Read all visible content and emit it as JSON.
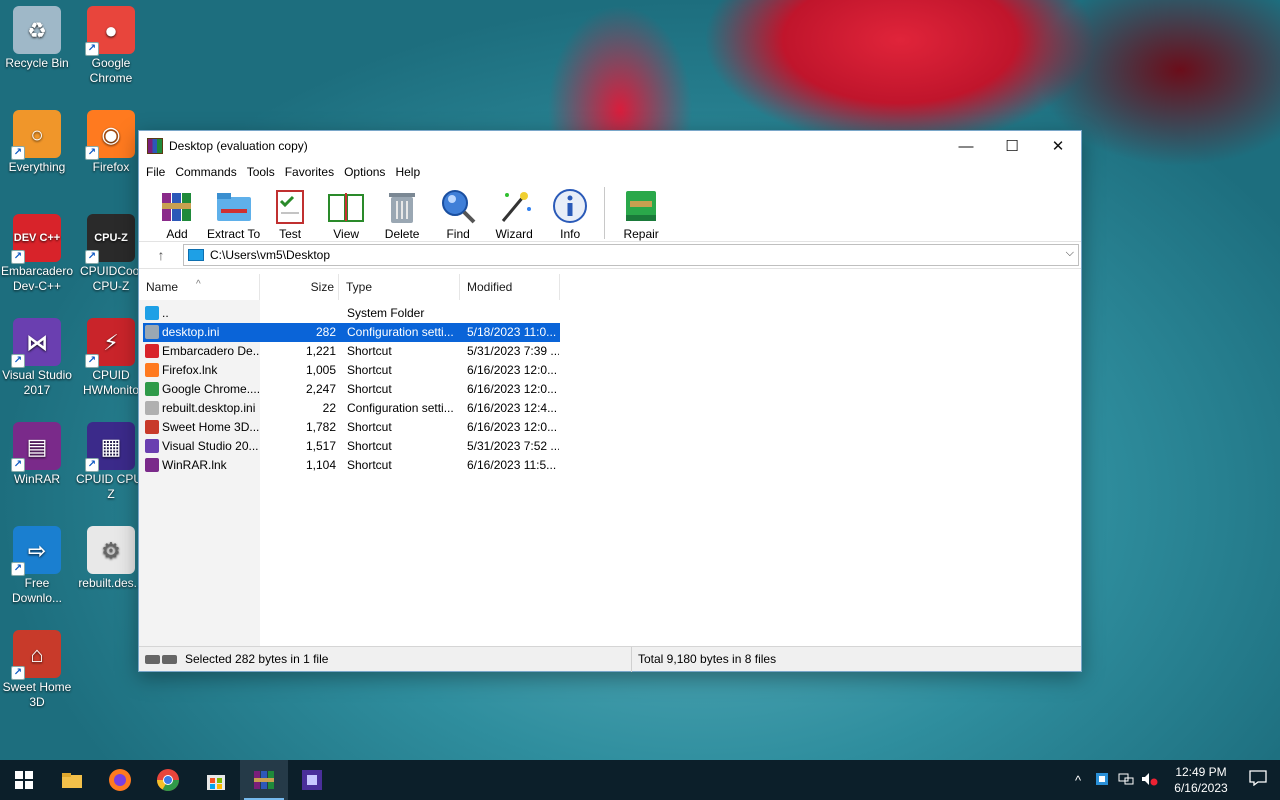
{
  "desktop": {
    "icons": [
      {
        "label": "Recycle Bin",
        "color": "#9fb8c8",
        "glyph": "♻",
        "shortcut": false
      },
      {
        "label": "Google Chrome",
        "color": "#e8453c",
        "glyph": "●",
        "shortcut": true
      },
      {
        "label": "Everything",
        "color": "#f0962a",
        "glyph": "○",
        "shortcut": true
      },
      {
        "label": "Firefox",
        "color": "#ff7a1f",
        "glyph": "◉",
        "shortcut": true
      },
      {
        "label": "Embarcadero Dev-C++",
        "color": "#d8232a",
        "glyph": "DEV C++",
        "shortcut": true
      },
      {
        "label": "CPUIDCool CPU-Z",
        "color": "#2a2a2a",
        "glyph": "CPU-Z",
        "shortcut": true
      },
      {
        "label": "Visual Studio 2017",
        "color": "#6a3fb0",
        "glyph": "⋈",
        "shortcut": true
      },
      {
        "label": "CPUID HWMonito",
        "color": "#c9242a",
        "glyph": "⚡",
        "shortcut": true
      },
      {
        "label": "WinRAR",
        "color": "#7a2a8a",
        "glyph": "▤",
        "shortcut": true
      },
      {
        "label": "CPUID CPU-Z",
        "color": "#3b2a8a",
        "glyph": "▦",
        "shortcut": true
      },
      {
        "label": "Free Downlo...",
        "color": "#1a7fd0",
        "glyph": "⇨",
        "shortcut": true
      },
      {
        "label": "rebuilt.des...",
        "color": "#e8e8e8",
        "glyph": "⚙",
        "shortcut": false
      },
      {
        "label": "Sweet Home 3D",
        "color": "#c83a2a",
        "glyph": "⌂",
        "shortcut": true
      }
    ]
  },
  "window": {
    "title": "Desktop (evaluation copy)",
    "controls": {
      "minimize": "—",
      "maximize": "☐",
      "close": "✕"
    },
    "menu": [
      "File",
      "Commands",
      "Tools",
      "Favorites",
      "Options",
      "Help"
    ],
    "toolbar": [
      {
        "label": "Add",
        "icon": "add-icon"
      },
      {
        "label": "Extract To",
        "icon": "extract-icon"
      },
      {
        "label": "Test",
        "icon": "test-icon"
      },
      {
        "label": "View",
        "icon": "view-icon"
      },
      {
        "label": "Delete",
        "icon": "delete-icon"
      },
      {
        "label": "Find",
        "icon": "find-icon"
      },
      {
        "label": "Wizard",
        "icon": "wizard-icon"
      },
      {
        "label": "Info",
        "icon": "info-icon"
      },
      {
        "label": "Repair",
        "icon": "repair-icon"
      }
    ],
    "address": {
      "up": "↑",
      "path": "C:\\Users\\vm5\\Desktop",
      "dropdown": "⌵"
    },
    "columns": {
      "name": "Name",
      "size": "Size",
      "type": "Type",
      "modified": "Modified"
    },
    "files": [
      {
        "name": "..",
        "size": "",
        "type": "System Folder",
        "modified": "",
        "icon_color": "#1ea0e6",
        "selected": false
      },
      {
        "name": "desktop.ini",
        "size": "282",
        "type": "Configuration setti...",
        "modified": "5/18/2023 11:0...",
        "icon_color": "#9aa7b3",
        "selected": true
      },
      {
        "name": "Embarcadero De...",
        "size": "1,221",
        "type": "Shortcut",
        "modified": "5/31/2023 7:39 ...",
        "icon_color": "#d8232a",
        "selected": false
      },
      {
        "name": "Firefox.lnk",
        "size": "1,005",
        "type": "Shortcut",
        "modified": "6/16/2023 12:0...",
        "icon_color": "#ff7a1f",
        "selected": false
      },
      {
        "name": "Google Chrome....",
        "size": "2,247",
        "type": "Shortcut",
        "modified": "6/16/2023 12:0...",
        "icon_color": "#2f9a49",
        "selected": false
      },
      {
        "name": "rebuilt.desktop.ini",
        "size": "22",
        "type": "Configuration setti...",
        "modified": "6/16/2023 12:4...",
        "icon_color": "#b0b0b0",
        "selected": false
      },
      {
        "name": "Sweet Home 3D....",
        "size": "1,782",
        "type": "Shortcut",
        "modified": "6/16/2023 12:0...",
        "icon_color": "#c83a2a",
        "selected": false
      },
      {
        "name": "Visual Studio 20...",
        "size": "1,517",
        "type": "Shortcut",
        "modified": "5/31/2023 7:52 ...",
        "icon_color": "#6a3fb0",
        "selected": false
      },
      {
        "name": "WinRAR.lnk",
        "size": "1,104",
        "type": "Shortcut",
        "modified": "6/16/2023 11:5...",
        "icon_color": "#7a2a8a",
        "selected": false
      }
    ],
    "status": {
      "left": "Selected 282 bytes in 1 file",
      "right": "Total 9,180 bytes in 8 files"
    }
  },
  "taskbar": {
    "items": [
      {
        "name": "start-button",
        "active": false
      },
      {
        "name": "file-explorer",
        "active": false
      },
      {
        "name": "firefox",
        "active": false
      },
      {
        "name": "chrome",
        "active": false
      },
      {
        "name": "store",
        "active": false
      },
      {
        "name": "winrar",
        "active": true
      },
      {
        "name": "cpu-z",
        "active": false
      }
    ],
    "tray": {
      "chevron": "^",
      "time": "12:49 PM",
      "date": "6/16/2023"
    }
  }
}
